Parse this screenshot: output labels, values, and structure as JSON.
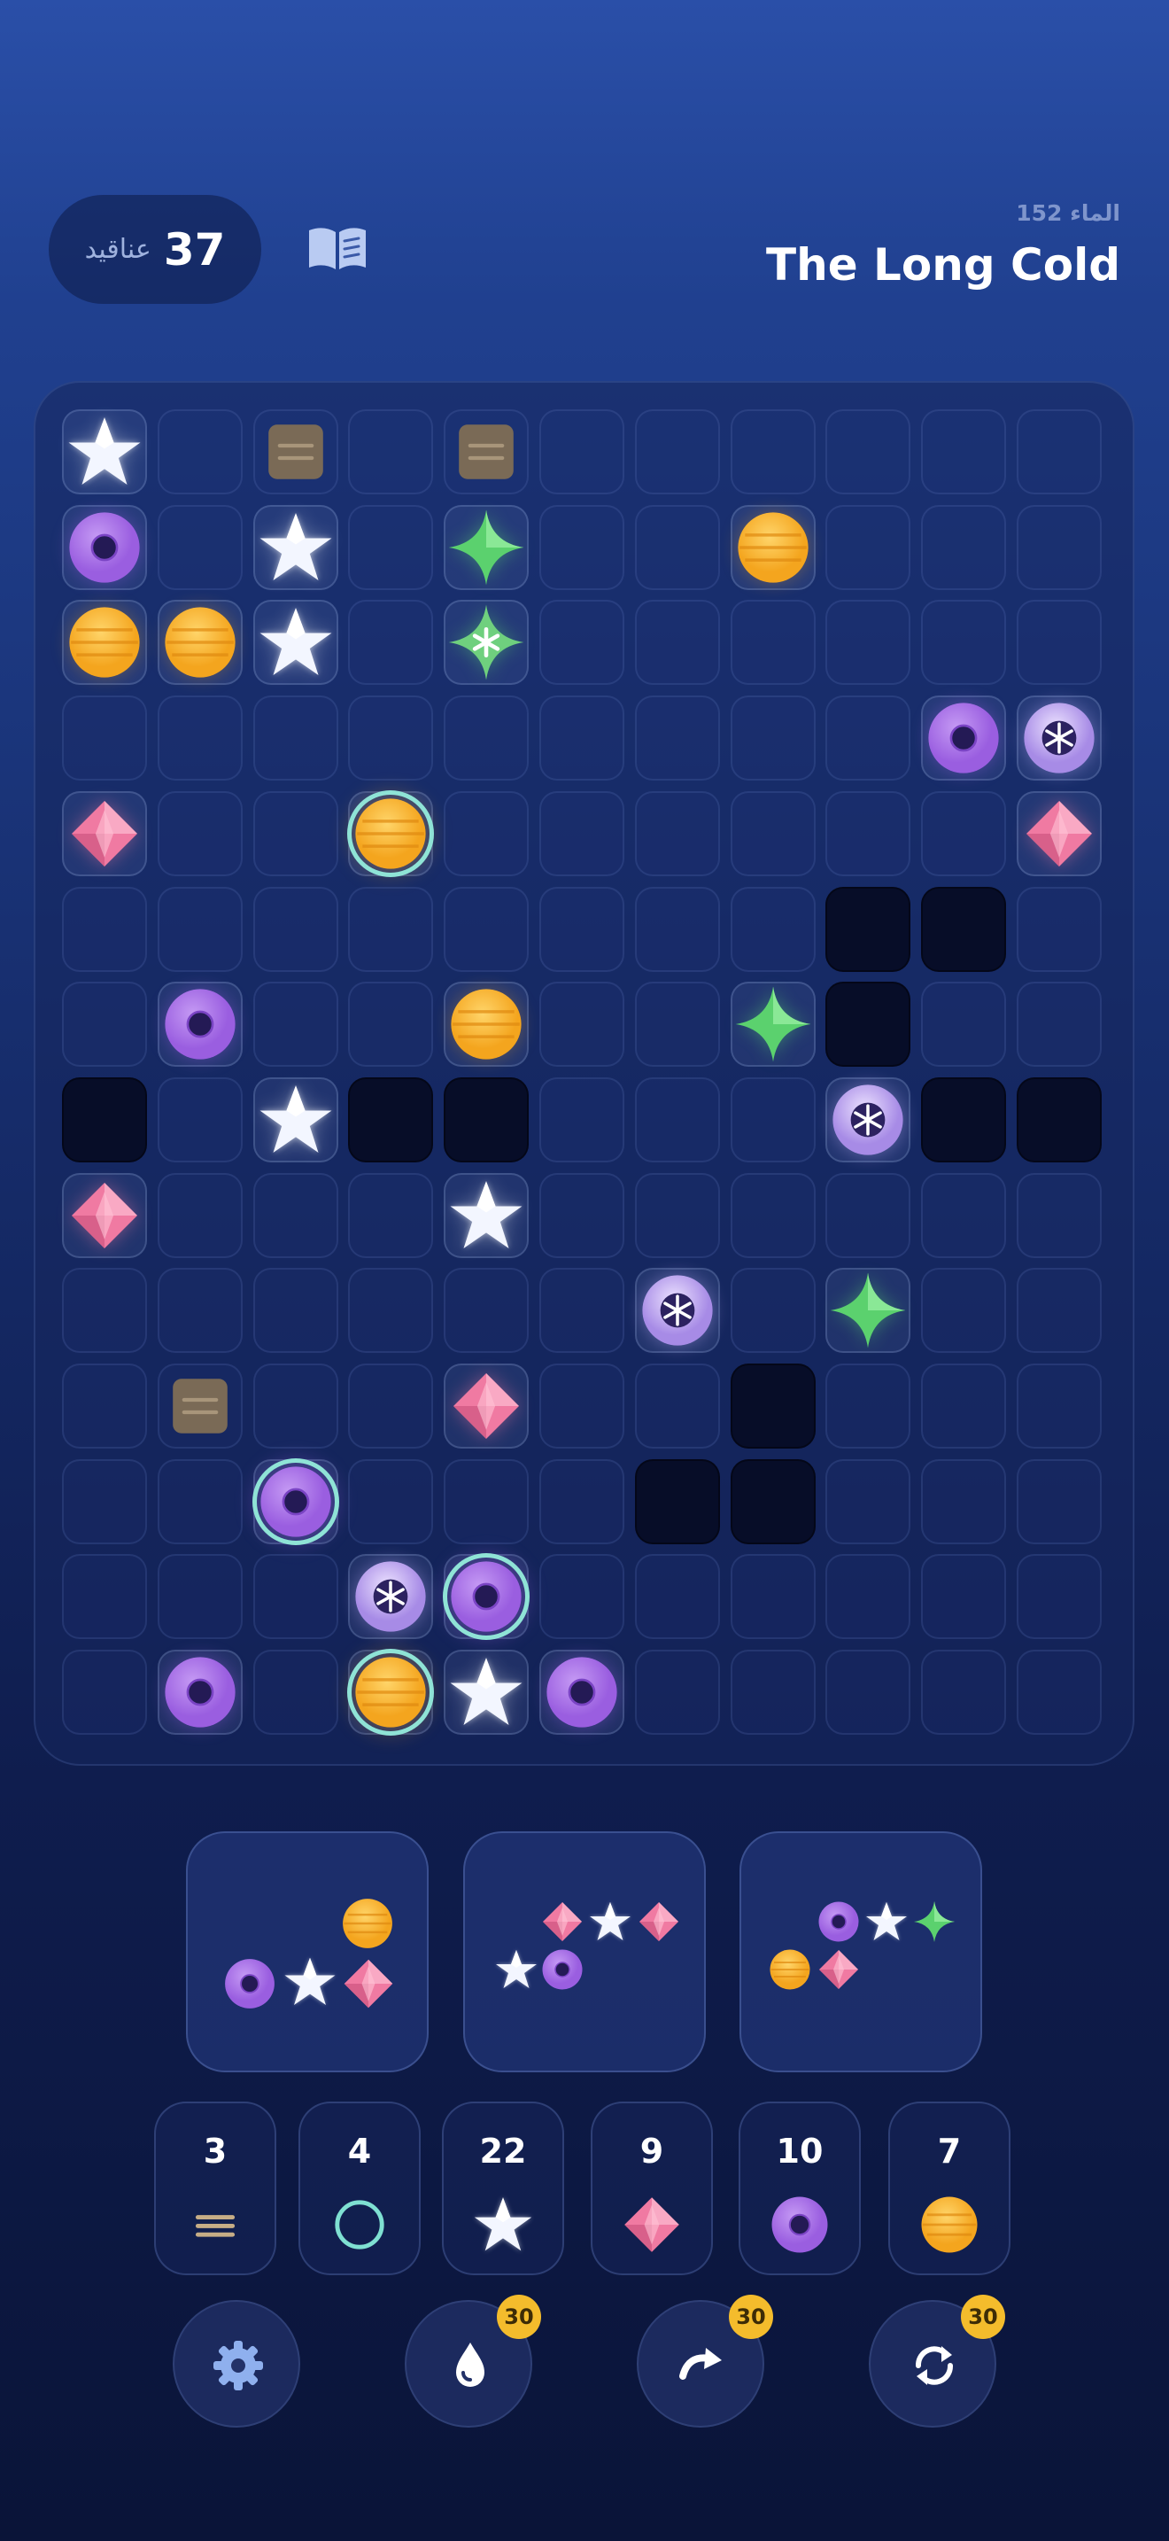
{
  "header": {
    "count": "37",
    "count_label": "عناقيد",
    "level": "152 الماء",
    "title": "The Long Cold"
  },
  "colors": {
    "star": "#f3f6ff",
    "gem": "#f07aa2",
    "ring": "#9a5ee0",
    "orb": "#f4a51e",
    "sparkle": "#5bd16e",
    "crate": "#7a6a56",
    "void": "#070d28",
    "accent": "#f4bc2c"
  },
  "board": {
    "cols": 11,
    "rows": 14,
    "legend": "S=star, G=gem, R=ring, RH=ring with ice halo, O=orb, OH=orb with ice halo, K=green sparkle, KF=frozen sparkle, F=snowflake bubble, C=crate, V=void, .=empty",
    "grid": [
      [
        "S",
        ".",
        "C",
        ".",
        "C",
        ".",
        ".",
        ".",
        ".",
        ".",
        "."
      ],
      [
        "R",
        ".",
        "S",
        ".",
        "K",
        ".",
        ".",
        "O",
        ".",
        ".",
        "."
      ],
      [
        "O",
        "O",
        "S",
        ".",
        "KF",
        ".",
        ".",
        ".",
        ".",
        ".",
        "."
      ],
      [
        ".",
        ".",
        ".",
        ".",
        ".",
        ".",
        ".",
        ".",
        ".",
        "R",
        "F"
      ],
      [
        "G",
        ".",
        ".",
        "OH",
        ".",
        ".",
        ".",
        ".",
        ".",
        ".",
        "G"
      ],
      [
        ".",
        ".",
        ".",
        ".",
        ".",
        ".",
        ".",
        ".",
        "V",
        "V",
        "."
      ],
      [
        ".",
        "R",
        ".",
        ".",
        "O",
        ".",
        ".",
        "K",
        "V",
        ".",
        "."
      ],
      [
        "V",
        ".",
        "S",
        "V",
        "V",
        ".",
        ".",
        ".",
        "F",
        "V",
        "V"
      ],
      [
        "G",
        ".",
        ".",
        ".",
        "S",
        ".",
        ".",
        ".",
        ".",
        ".",
        "."
      ],
      [
        ".",
        ".",
        ".",
        ".",
        ".",
        ".",
        "F",
        ".",
        "K",
        ".",
        "."
      ],
      [
        ".",
        "C",
        ".",
        ".",
        "G",
        ".",
        ".",
        "V",
        ".",
        ".",
        "."
      ],
      [
        ".",
        ".",
        "RH",
        ".",
        ".",
        ".",
        "V",
        "V",
        ".",
        ".",
        "."
      ],
      [
        ".",
        ".",
        ".",
        "F",
        "RH",
        ".",
        ".",
        ".",
        ".",
        ".",
        "."
      ],
      [
        ".",
        "R",
        ".",
        "OH",
        "S",
        "R",
        ".",
        ".",
        ".",
        ".",
        "."
      ]
    ]
  },
  "trays": [
    {
      "name": "tray-1",
      "pieces": [
        "orb",
        "ring",
        "star",
        "gem"
      ]
    },
    {
      "name": "tray-2",
      "pieces": [
        "gem",
        "star",
        "gem",
        "star",
        "ring"
      ]
    },
    {
      "name": "tray-3",
      "pieces": [
        "ring",
        "star",
        "sparkle",
        "orb",
        "gem"
      ]
    }
  ],
  "counters": [
    {
      "count": "3",
      "icon": "crate-icon"
    },
    {
      "count": "4",
      "icon": "ice-ring-icon"
    },
    {
      "count": "22",
      "icon": "star-icon"
    },
    {
      "count": "9",
      "icon": "gem-icon"
    },
    {
      "count": "10",
      "icon": "ring-icon"
    },
    {
      "count": "7",
      "icon": "orb-icon"
    }
  ],
  "controls": [
    {
      "name": "settings-button",
      "icon": "gear-icon",
      "badge": ""
    },
    {
      "name": "drop-button",
      "icon": "drop-icon",
      "badge": "30"
    },
    {
      "name": "redo-button",
      "icon": "redo-icon",
      "badge": "30"
    },
    {
      "name": "shuffle-button",
      "icon": "shuffle-icon",
      "badge": "30"
    }
  ]
}
